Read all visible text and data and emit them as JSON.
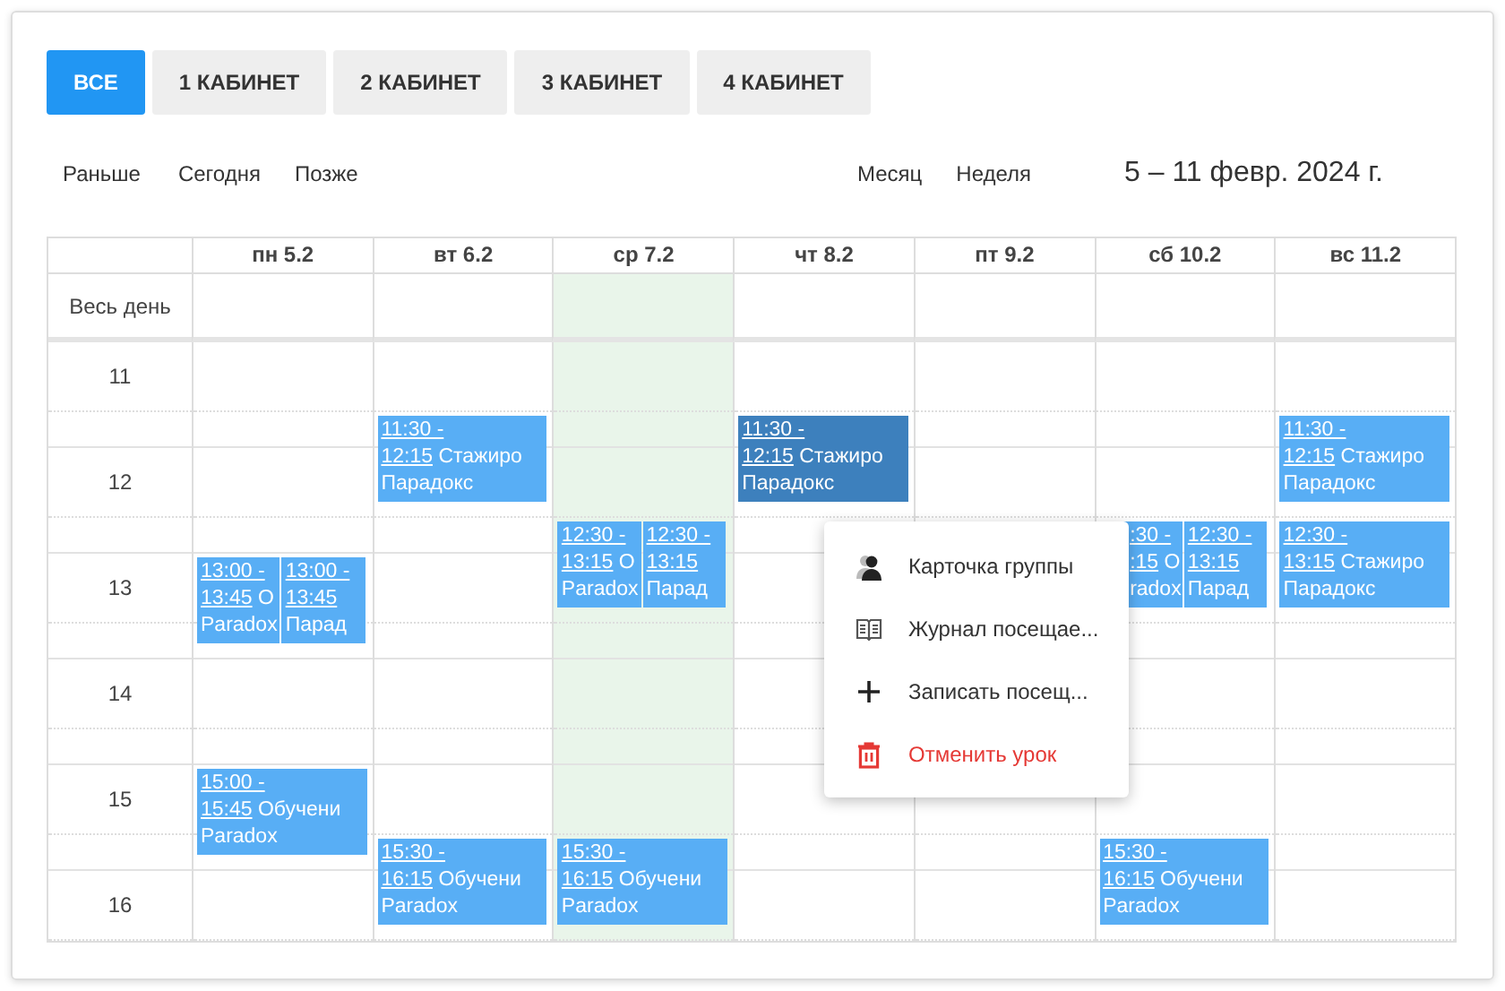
{
  "tabs": [
    {
      "label": "ВСЕ",
      "selected": true
    },
    {
      "label": "1 КАБИНЕТ",
      "selected": false
    },
    {
      "label": "2 КАБИНЕТ",
      "selected": false
    },
    {
      "label": "3 КАБИНЕТ",
      "selected": false
    },
    {
      "label": "4 КАБИНЕТ",
      "selected": false
    }
  ],
  "nav": {
    "back": "Раньше",
    "today": "Сегодня",
    "forward": "Позже"
  },
  "views": [
    "Месяц",
    "Неделя"
  ],
  "date_range": "5 – 11 февр. 2024 г.",
  "calendar": {
    "all_day_label": "Весь день",
    "hours": [
      "11",
      "12",
      "13",
      "14",
      "15",
      "16"
    ],
    "days": [
      {
        "label": "пн 5.2",
        "today": false,
        "events": [
          {
            "start": "13:00 -",
            "end": "13:45",
            "title": "О",
            "group": "Paradox",
            "selected": false
          },
          {
            "start": "13:00 -",
            "end": "13:45",
            "group": "Парад",
            "selected": false
          },
          {
            "start": "15:00 -",
            "end": "15:45",
            "title": "Обучени",
            "group": "Paradox",
            "selected": false
          }
        ]
      },
      {
        "label": "вт 6.2",
        "today": false,
        "events": [
          {
            "start": "11:30 -",
            "end": "12:15",
            "title": "Стажиро",
            "group": "Парадокс",
            "selected": false
          },
          {
            "start": "15:30 -",
            "end": "16:15",
            "title": "Обучени",
            "group": "Paradox",
            "selected": false
          }
        ]
      },
      {
        "label": "ср 7.2",
        "today": true,
        "events": [
          {
            "start": "12:30 -",
            "end": "13:15",
            "title": "О",
            "group": "Paradox",
            "selected": false
          },
          {
            "start": "12:30 -",
            "end": "13:15",
            "group": "Парад",
            "selected": false
          },
          {
            "start": "15:30 -",
            "end": "16:15",
            "title": "Обучени",
            "group": "Paradox",
            "selected": false
          }
        ]
      },
      {
        "label": "чт 8.2",
        "today": false,
        "events": [
          {
            "start": "11:30 -",
            "end": "12:15",
            "title": "Стажиро",
            "group": "Парадокс",
            "selected": true
          }
        ]
      },
      {
        "label": "пт 9.2",
        "today": false
      },
      {
        "label": "сб 10.2",
        "today": false,
        "events": [
          {
            "start": ":30 -",
            "end": ":15",
            "title": "О",
            "group": "radox",
            "selected": false,
            "hidden_left": true
          },
          {
            "start": "12:30 -",
            "end": "13:15",
            "group": "Парад",
            "selected": false
          },
          {
            "start": "15:30 -",
            "end": "16:15",
            "title": "Обучени",
            "group": "Paradox",
            "selected": false
          }
        ]
      },
      {
        "label": "вс 11.2",
        "today": false,
        "events": [
          {
            "start": "11:30 -",
            "end": "12:15",
            "title": "Стажиро",
            "group": "Парадокс",
            "selected": false
          },
          {
            "start": "12:30 -",
            "end": "13:15",
            "title": "Стажиро",
            "group": "Парадокс",
            "selected": false
          }
        ]
      }
    ]
  },
  "context_menu": {
    "items": [
      {
        "label": "Карточка группы",
        "kind": "normal"
      },
      {
        "label": "Журнал посещае...",
        "kind": "normal"
      },
      {
        "label": "Записать посещ...",
        "kind": "normal"
      },
      {
        "label": "Отменить урок",
        "kind": "danger"
      }
    ]
  }
}
